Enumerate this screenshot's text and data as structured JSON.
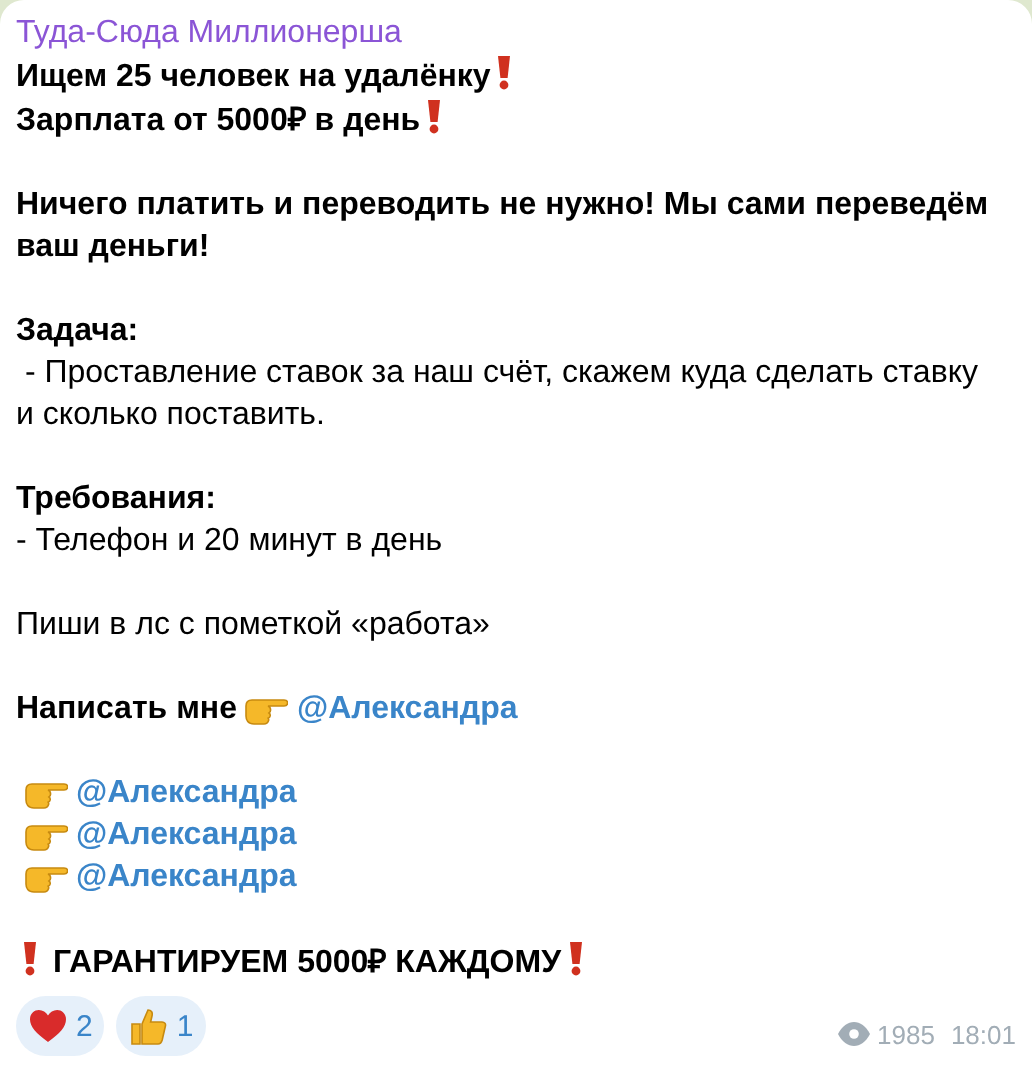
{
  "message": {
    "author": "Туда-Сюда Миллионерша",
    "groups": [
      [
        {
          "kind": "alert",
          "text": "Ищем 25 человек на удалёнку",
          "lead": false,
          "trail": true
        },
        {
          "kind": "alert",
          "text": "Зарплата от 5000₽ в день",
          "lead": false,
          "trail": true
        }
      ],
      [
        {
          "kind": "paragraph",
          "bold": true,
          "lines": [
            "Ничего платить и переводить не нужно! Мы сами переведём",
            "ваш деньги!"
          ]
        }
      ],
      [
        {
          "kind": "paragraph",
          "bold": true,
          "lines": [
            "Задача:"
          ]
        },
        {
          "kind": "paragraph",
          "bold": false,
          "lines": [
            " - Проставление ставок за наш счёт, скажем куда сделать ставку",
            "и сколько поставить."
          ]
        }
      ],
      [
        {
          "kind": "paragraph",
          "bold": true,
          "lines": [
            "Требования:"
          ]
        },
        {
          "kind": "paragraph",
          "bold": false,
          "lines": [
            "- Телефон и 20 минут в день"
          ]
        }
      ],
      [
        {
          "kind": "paragraph",
          "bold": false,
          "lines": [
            "Пиши в лс с пометкой «работа»"
          ]
        }
      ],
      [
        {
          "kind": "contact",
          "label": "Написать мне",
          "mention": "@Александра"
        }
      ],
      [
        {
          "kind": "mention",
          "mention": "@Александра"
        },
        {
          "kind": "mention",
          "mention": "@Александра"
        },
        {
          "kind": "mention",
          "mention": "@Александра"
        }
      ],
      [
        {
          "kind": "alert",
          "text": "ГАРАНТИРУЕМ 5000₽ КАЖДОМУ",
          "lead": true,
          "trail": true
        }
      ]
    ],
    "reactions": [
      {
        "kind": "heart",
        "count": "2"
      },
      {
        "kind": "thumbs_up",
        "count": "1"
      }
    ],
    "views": "1985",
    "time": "18:01"
  }
}
